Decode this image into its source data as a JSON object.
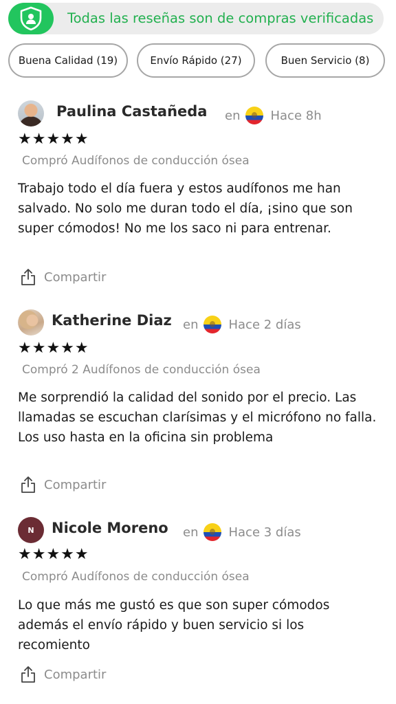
{
  "banner": {
    "text": "Todas las reseñas son de compras verificadas",
    "accent": "#22c55e"
  },
  "filters": [
    {
      "label": "Buena Calidad (19)"
    },
    {
      "label": "Envío Rápido (27)"
    },
    {
      "label": "Buen Servicio (8)"
    }
  ],
  "reviews": [
    {
      "name": "Paulina Castañeda",
      "location_prefix": "en",
      "time": "Hace 8h",
      "stars": "★★★★★",
      "purchase": "Compró Audífonos de conducción ósea",
      "text": "Trabajo todo el día fuera y estos audífonos me han salvado. No solo me duran todo el día, ¡sino que son super cómodos! No me los saco ni para entrenar.",
      "share_label": "Compartir"
    },
    {
      "name": "Katherine Diaz",
      "location_prefix": "en",
      "time": "Hace 2 días",
      "stars": "★★★★★",
      "purchase": "Compró 2 Audífonos de conducción ósea",
      "text": "Me sorprendió la calidad del sonido por el precio. Las llamadas se escuchan clarísimas y el micrófono no falla. Los uso hasta en la oficina sin problema",
      "share_label": "Compartir"
    },
    {
      "name": "Nicole Moreno",
      "avatar_initial": "N",
      "location_prefix": "en",
      "time": "Hace 3 días",
      "stars": "★★★★★",
      "purchase": "Compró Audífonos de conducción ósea",
      "text": "Lo que más me gustó es que son super cómodos además el envío rápido y buen servicio si los recomiento",
      "share_label": "Compartir"
    }
  ],
  "icons": {
    "verified": "shield-user-icon",
    "share": "share-icon",
    "flag": "ecuador-flag-icon"
  }
}
